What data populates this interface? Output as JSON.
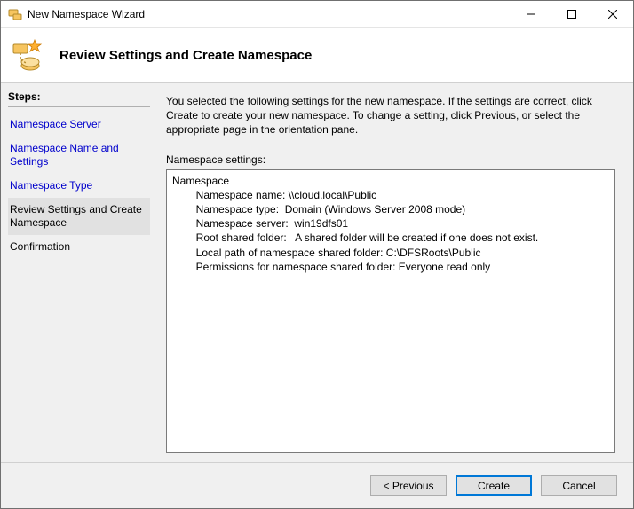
{
  "window": {
    "title": "New Namespace Wizard"
  },
  "banner": {
    "page_title": "Review Settings and Create Namespace"
  },
  "steps": {
    "heading": "Steps:",
    "items": [
      {
        "label": "Namespace Server",
        "state": "link"
      },
      {
        "label": "Namespace Name and Settings",
        "state": "link"
      },
      {
        "label": "Namespace Type",
        "state": "link"
      },
      {
        "label": "Review Settings and Create Namespace",
        "state": "current"
      },
      {
        "label": "Confirmation",
        "state": "disabled"
      }
    ]
  },
  "content": {
    "instructions": "You selected the following settings for the new namespace. If the settings are correct, click Create to create your new namespace. To change a setting, click Previous, or select the appropriate page in the orientation pane.",
    "settings_label": "Namespace settings:",
    "settings_lines": [
      "Namespace",
      "\tNamespace name: \\\\cloud.local\\Public",
      "\tNamespace type:  Domain (Windows Server 2008 mode)",
      "\tNamespace server:  win19dfs01",
      "\tRoot shared folder:   A shared folder will be created if one does not exist.",
      "\tLocal path of namespace shared folder: C:\\DFSRoots\\Public",
      "\tPermissions for namespace shared folder: Everyone read only"
    ]
  },
  "footer": {
    "previous": "< Previous",
    "create": "Create",
    "cancel": "Cancel"
  }
}
